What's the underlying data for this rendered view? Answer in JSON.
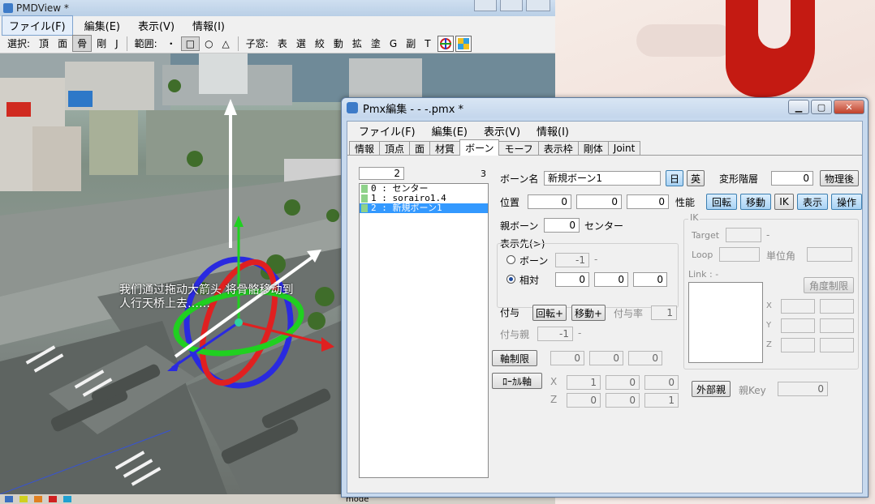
{
  "pmdview": {
    "title": "PMDView *",
    "menu": [
      "ファイル(F)",
      "編集(E)",
      "表示(V)",
      "情報(I)"
    ],
    "toolbar": {
      "select_label": "選択:",
      "select_items": [
        "頂",
        "面",
        "骨",
        "剛",
        "J"
      ],
      "range_label": "範囲:",
      "range_items": [
        "・",
        "□",
        "○",
        "△"
      ],
      "child_label": "子窓:",
      "child_items": [
        "表",
        "選",
        "絞",
        "動",
        "拡",
        "塗",
        "G",
        "副",
        "T"
      ]
    },
    "overlay_text_line1": "我们通过拖动大箭头 将骨骼移动到",
    "overlay_text_line2": "人行天桥上去……",
    "status_text": "mode"
  },
  "pmx": {
    "title": "Pmx編集 - - -.pmx *",
    "menu": [
      "ファイル(F)",
      "編集(E)",
      "表示(V)",
      "情報(I)"
    ],
    "tabs": [
      "情報",
      "頂点",
      "面",
      "材質",
      "ボーン",
      "モーフ",
      "表示枠",
      "剛体",
      "Joint"
    ],
    "active_tab": "ボーン",
    "bone_count_value": "2",
    "bone_total": "3",
    "bones": [
      {
        "index": "0",
        "name": "センター"
      },
      {
        "index": "1",
        "name": "sorairo1.4"
      },
      {
        "index": "2",
        "name": "新規ボーン1"
      }
    ],
    "selected_bone": "2",
    "bone_name_label": "ボーン名",
    "bone_name_value": "新規ボーン1",
    "lang_jp": "日",
    "lang_en": "英",
    "deform_label": "変形階層",
    "deform_value": "0",
    "physics_after": "物理後",
    "position_label": "位置",
    "position": [
      "0",
      "0",
      "0"
    ],
    "perf_label": "性能",
    "perf_buttons": [
      "回転",
      "移動",
      "IK",
      "表示",
      "操作"
    ],
    "parent_label": "親ボーン",
    "parent_value": "0",
    "parent_name": "センター",
    "display_dest_label": "表示先(>)",
    "radio_bone_label": "ボーン",
    "radio_bone_value": "-1",
    "radio_bone_dash": "-",
    "radio_rel_label": "相対",
    "rel_values": [
      "0",
      "0",
      "0"
    ],
    "ik_group": "IK",
    "ik_target_label": "Target",
    "ik_target_dash": "-",
    "ik_loop_label": "Loop",
    "ik_unit_angle_label": "単位角",
    "ik_link_label": "Link : -",
    "ik_angle_limit": "角度制限",
    "ik_axes": [
      "X",
      "Y",
      "Z"
    ],
    "grant_label": "付与",
    "grant_rot": "回転+",
    "grant_move": "移動+",
    "grant_rate_label": "付与率",
    "grant_rate_value": "1",
    "grant_parent_label": "付与親",
    "grant_parent_value": "-1",
    "grant_parent_dash": "-",
    "axis_limit": "軸制限",
    "axis_values": [
      "0",
      "0",
      "0"
    ],
    "local_axis": "ﾛｰｶﾙ軸",
    "local_x_label": "X",
    "local_x": [
      "1",
      "0",
      "0"
    ],
    "local_z_label": "Z",
    "local_z": [
      "0",
      "0",
      "1"
    ],
    "external_parent": "外部親",
    "parent_key_label": "親Key",
    "parent_key_value": "0"
  }
}
